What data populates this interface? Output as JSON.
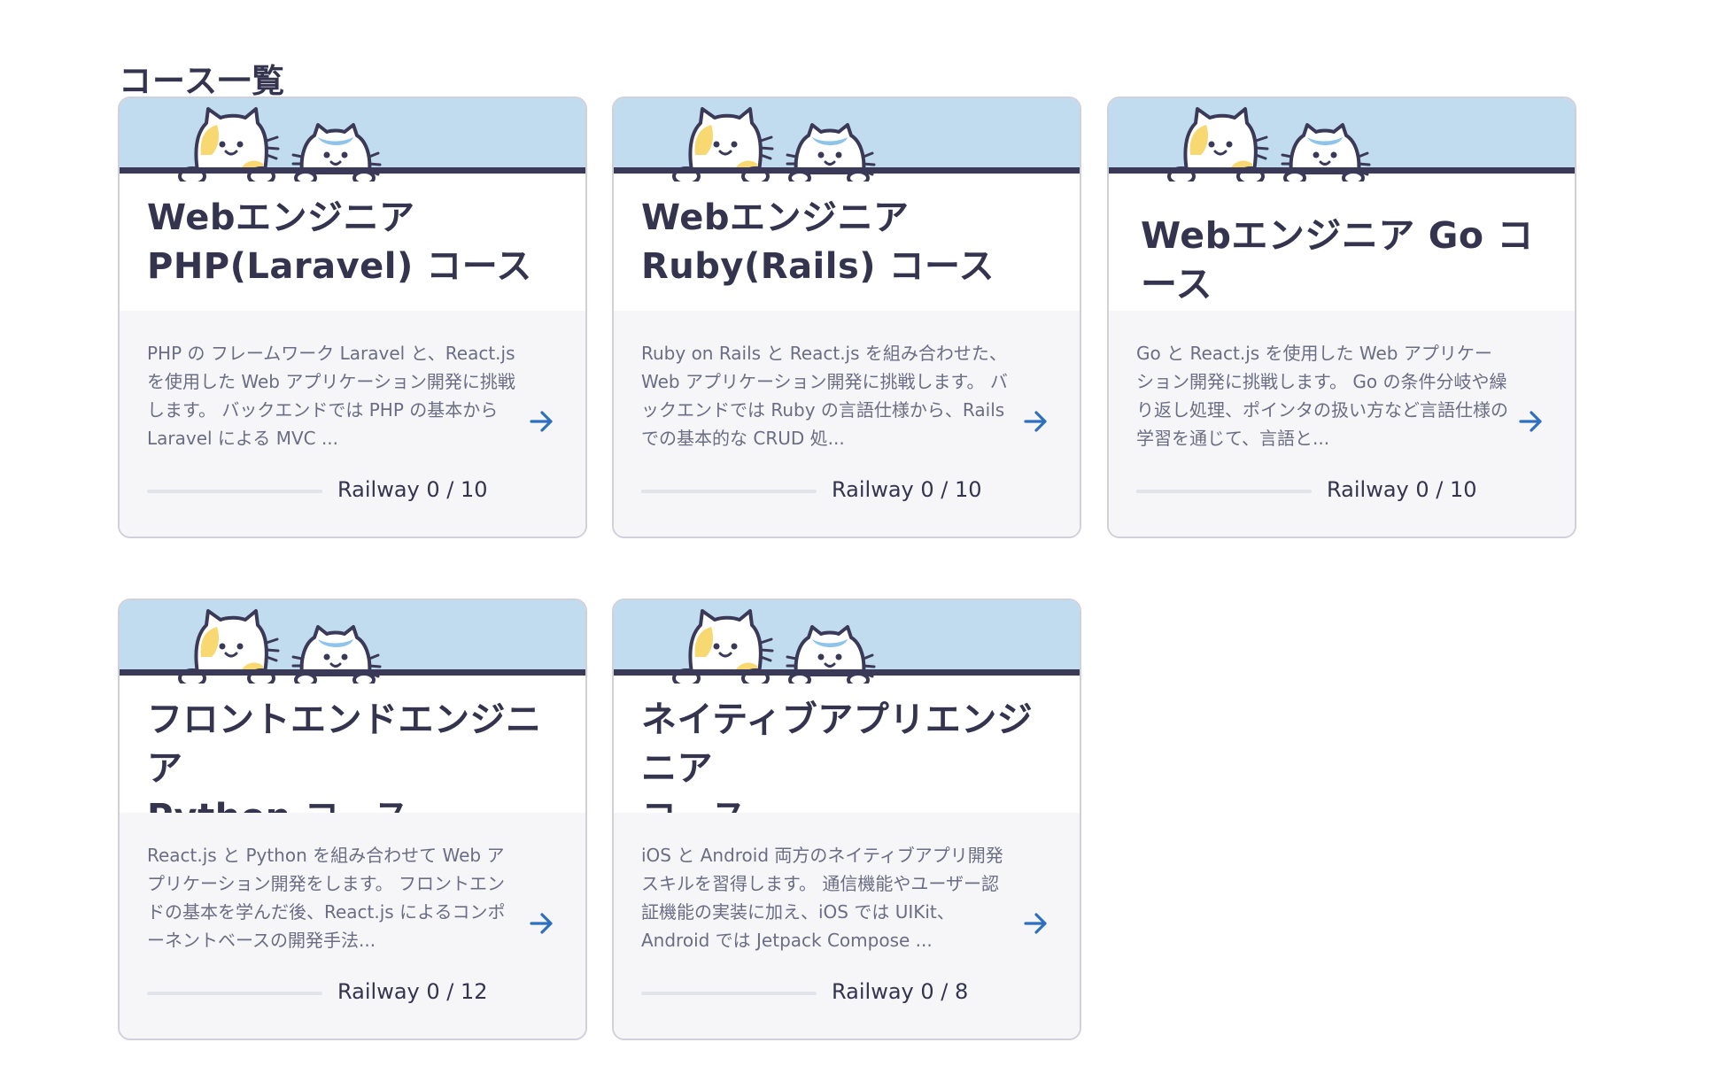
{
  "page": {
    "title": "コース一覧"
  },
  "courses": [
    {
      "title": "Webエンジニア\nPHP(Laravel) コース",
      "description": "PHP の フレームワーク Laravel と、React.js を使用した Web アプリケーション開発に挑戦します。 バックエンドでは PHP の基本から Laravel による MVC ...",
      "progress_label": "Railway 0 / 10",
      "progress_done": 0,
      "progress_total": 10
    },
    {
      "title": "Webエンジニア\nRuby(Rails) コース",
      "description": "Ruby on Rails と React.js を組み合わせた、Web アプリケーション開発に挑戦します。 バックエンドでは Ruby の言語仕様から、Rails での基本的な CRUD 処...",
      "progress_label": "Railway 0 / 10",
      "progress_done": 0,
      "progress_total": 10
    },
    {
      "title": "Webエンジニア Go コース",
      "description": "Go と React.js を使用した Web アプリケーション開発に挑戦します。 Go の条件分岐や繰り返し処理、ポインタの扱い方など言語仕様の学習を通じて、言語と...",
      "progress_label": "Railway 0 / 10",
      "progress_done": 0,
      "progress_total": 10
    },
    {
      "title": "フロントエンドエンジニア\nPython コース",
      "description": "React.js と Python を組み合わせて Web アプリケーション開発をします。 フロントエンドの基本を学んだ後、React.js によるコンポーネントベースの開発手法...",
      "progress_label": "Railway 0 / 12",
      "progress_done": 0,
      "progress_total": 12
    },
    {
      "title": "ネイティブアプリエンジニア\nコース",
      "description": "iOS と Android 両方のネイティブアプリ開発スキルを習得します。 通信機能やユーザー認証機能の実装に加え、iOS では UIKit、Android では Jetpack Compose ...",
      "progress_label": "Railway 0 / 8",
      "progress_done": 0,
      "progress_total": 8
    }
  ],
  "colors": {
    "header_bg": "#c2dcef",
    "ink": "#3a3a58",
    "accent": "#2f6fbf",
    "cat_yellow": "#f8d870",
    "cat_blue": "#8ec3ea"
  },
  "icons": {
    "mascot": "cats-mascot-icon",
    "arrow": "arrow-right-icon"
  }
}
